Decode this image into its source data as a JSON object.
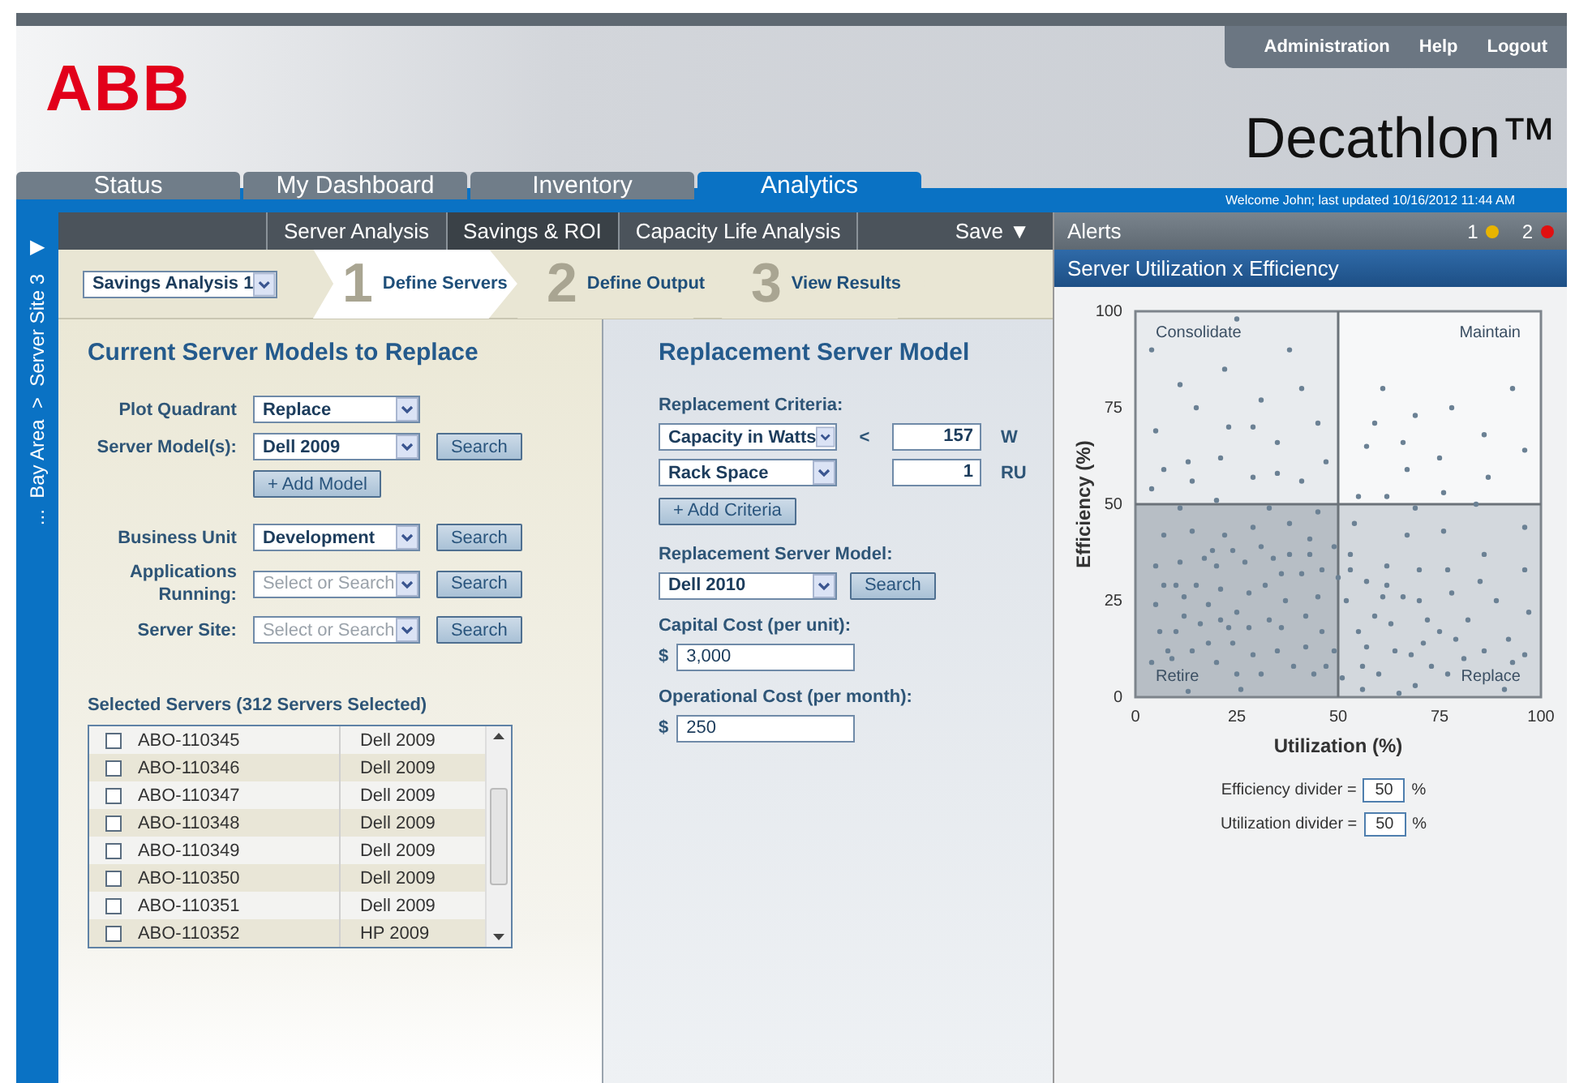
{
  "header": {
    "logo": "ABB",
    "product": "Decathlon™",
    "utility_links": [
      "Administration",
      "Help",
      "Logout"
    ],
    "welcome": "Welcome John;  last updated 10/16/2012 11:44 AM"
  },
  "tabs": [
    {
      "label": "Status",
      "selected": false
    },
    {
      "label": "My Dashboard",
      "selected": false
    },
    {
      "label": "Inventory",
      "selected": false
    },
    {
      "label": "Analytics",
      "selected": true
    }
  ],
  "sidebar": {
    "toggle": "▶",
    "breadcrumb": "...  Bay Area  >  Server Site 3"
  },
  "subnav": {
    "items": [
      {
        "label": "Server Analysis",
        "selected": false
      },
      {
        "label": "Savings & ROI",
        "selected": true
      },
      {
        "label": "Capacity Life Analysis",
        "selected": false
      }
    ],
    "save": "Save ▼"
  },
  "wizard": {
    "analysis": "Savings Analysis 1",
    "steps": [
      {
        "number": "1",
        "label": "Define Servers",
        "selected": true
      },
      {
        "number": "2",
        "label": "Define Output",
        "selected": false
      },
      {
        "number": "3",
        "label": "View Results",
        "selected": false
      }
    ]
  },
  "current": {
    "title": "Current Server Models to Replace",
    "fields": [
      {
        "label": "Plot Quadrant",
        "value": "Replace"
      },
      {
        "label": "Server Model(s):",
        "value": "Dell 2009",
        "button": "Search",
        "extra_button": "+ Add Model"
      },
      {
        "label": "Business Unit",
        "value": "Development",
        "button": "Search"
      },
      {
        "label": "Applications Running:",
        "placeholder": "Select or Search",
        "button": "Search"
      },
      {
        "label": "Server Site:",
        "placeholder": "Select or Search",
        "button": "Search"
      }
    ],
    "selected_label": "Selected Servers  (312 Servers Selected)",
    "servers": [
      {
        "id": "ABO-110345",
        "model": "Dell 2009",
        "checked": false
      },
      {
        "id": "ABO-110346",
        "model": "Dell 2009",
        "checked": false
      },
      {
        "id": "ABO-110347",
        "model": "Dell 2009",
        "checked": false
      },
      {
        "id": "ABO-110348",
        "model": "Dell 2009",
        "checked": false
      },
      {
        "id": "ABO-110349",
        "model": "Dell 2009",
        "checked": false
      },
      {
        "id": "ABO-110350",
        "model": "Dell 2009",
        "checked": false
      },
      {
        "id": "ABO-110351",
        "model": "Dell 2009",
        "checked": false
      },
      {
        "id": "ABO-110352",
        "model": "HP 2009",
        "checked": false
      }
    ]
  },
  "replacement": {
    "title": "Replacement Server Model",
    "criteria_label": "Replacement Criteria:",
    "criteria": [
      {
        "field": "Capacity in Watts",
        "operator": "<",
        "value": "157",
        "unit": "W"
      },
      {
        "field": "Rack Space",
        "value": "1",
        "unit": "RU"
      }
    ],
    "add_criteria": "+ Add Criteria",
    "model_label": "Replacement Server Model:",
    "model": "Dell 2010",
    "model_button": "Search",
    "costs": [
      {
        "label": "Capital Cost (per unit):",
        "currency": "$",
        "value": "3,000"
      },
      {
        "label": "Operational Cost (per month):",
        "currency": "$",
        "value": "250"
      }
    ]
  },
  "alerts": {
    "title": "Alerts",
    "counts": [
      {
        "count": "1",
        "color": "#e8b400"
      },
      {
        "count": "2",
        "color": "#e01010"
      }
    ]
  },
  "chart_panel": {
    "title": "Server Utilization x Efficiency",
    "chart_data": {
      "type": "scatter",
      "xlabel": "Utilization (%)",
      "ylabel": "Efficiency (%)",
      "xlim": [
        0,
        100
      ],
      "ylim": [
        0,
        100
      ],
      "xticks": [
        0,
        25,
        50,
        75,
        100
      ],
      "yticks": [
        0,
        25,
        50,
        75,
        100
      ],
      "x": [
        4,
        25,
        38,
        22,
        11,
        15,
        5,
        23,
        29,
        31,
        41,
        45,
        7,
        13,
        21,
        35,
        47,
        4,
        14,
        29,
        35,
        41,
        20,
        61,
        93,
        59,
        69,
        78,
        57,
        66,
        86,
        96,
        75,
        67,
        87,
        55,
        62,
        76,
        84,
        69,
        4,
        5,
        5,
        6,
        7,
        7,
        8,
        9,
        10,
        10,
        11,
        11,
        12,
        12,
        13,
        14,
        14,
        15,
        16,
        17,
        18,
        18,
        19,
        20,
        20,
        21,
        21,
        22,
        23,
        24,
        24,
        25,
        25,
        26,
        27,
        28,
        28,
        29,
        29,
        31,
        31,
        32,
        33,
        33,
        34,
        35,
        36,
        36,
        37,
        38,
        38,
        39,
        41,
        42,
        42,
        43,
        43,
        44,
        45,
        45,
        46,
        46,
        47,
        49,
        49,
        50,
        51,
        52,
        53,
        53,
        54,
        55,
        56,
        56,
        57,
        57,
        59,
        60,
        61,
        62,
        62,
        63,
        64,
        65,
        66,
        67,
        68,
        69,
        70,
        70,
        71,
        72,
        73,
        75,
        76,
        77,
        77,
        78,
        79,
        81,
        82,
        85,
        86,
        86,
        89,
        91,
        92,
        93,
        96,
        96,
        96,
        97
      ],
      "series": [
        {
          "color": "#6b8194",
          "values": [
            90,
            98,
            90,
            85,
            81,
            75,
            69,
            70,
            70,
            77,
            80,
            71,
            59,
            61,
            62,
            66,
            61,
            54,
            56,
            57,
            58,
            56,
            51,
            80,
            80,
            71,
            73,
            75,
            65,
            66,
            68,
            64,
            62,
            59,
            57,
            52,
            52,
            53,
            50,
            49,
            9,
            24,
            34,
            17,
            29,
            42,
            12,
            10,
            29,
            17,
            35,
            49,
            26,
            21,
            1.5,
            12,
            43,
            29,
            19,
            36,
            24,
            14,
            38,
            34,
            9,
            28,
            20,
            42,
            18,
            38,
            14,
            6,
            22,
            2,
            35,
            27,
            18,
            11,
            44,
            39,
            6,
            29,
            49,
            20,
            36,
            12,
            32,
            18,
            25,
            45,
            37,
            8,
            32,
            21,
            13,
            37,
            41,
            6,
            26,
            48,
            33,
            17,
            8,
            12,
            39,
            31,
            5,
            25,
            37,
            33,
            45,
            17,
            8,
            2,
            30,
            13,
            21,
            6,
            26,
            34,
            29,
            19,
            12,
            1,
            26,
            42,
            11,
            3,
            25,
            33,
            14,
            20,
            8,
            17,
            43,
            6,
            33,
            27,
            15,
            10,
            20,
            30,
            12,
            37,
            25,
            2,
            15,
            9,
            44,
            33,
            11,
            22
          ]
        }
      ]
    },
    "quadrant_labels": [
      "Consolidate",
      "Maintain",
      "Retire",
      "Replace"
    ],
    "dividers": [
      {
        "label": "Efficiency divider =",
        "value": "50",
        "unit": "%"
      },
      {
        "label": "Utilization divider =",
        "value": "50",
        "unit": "%"
      }
    ]
  }
}
